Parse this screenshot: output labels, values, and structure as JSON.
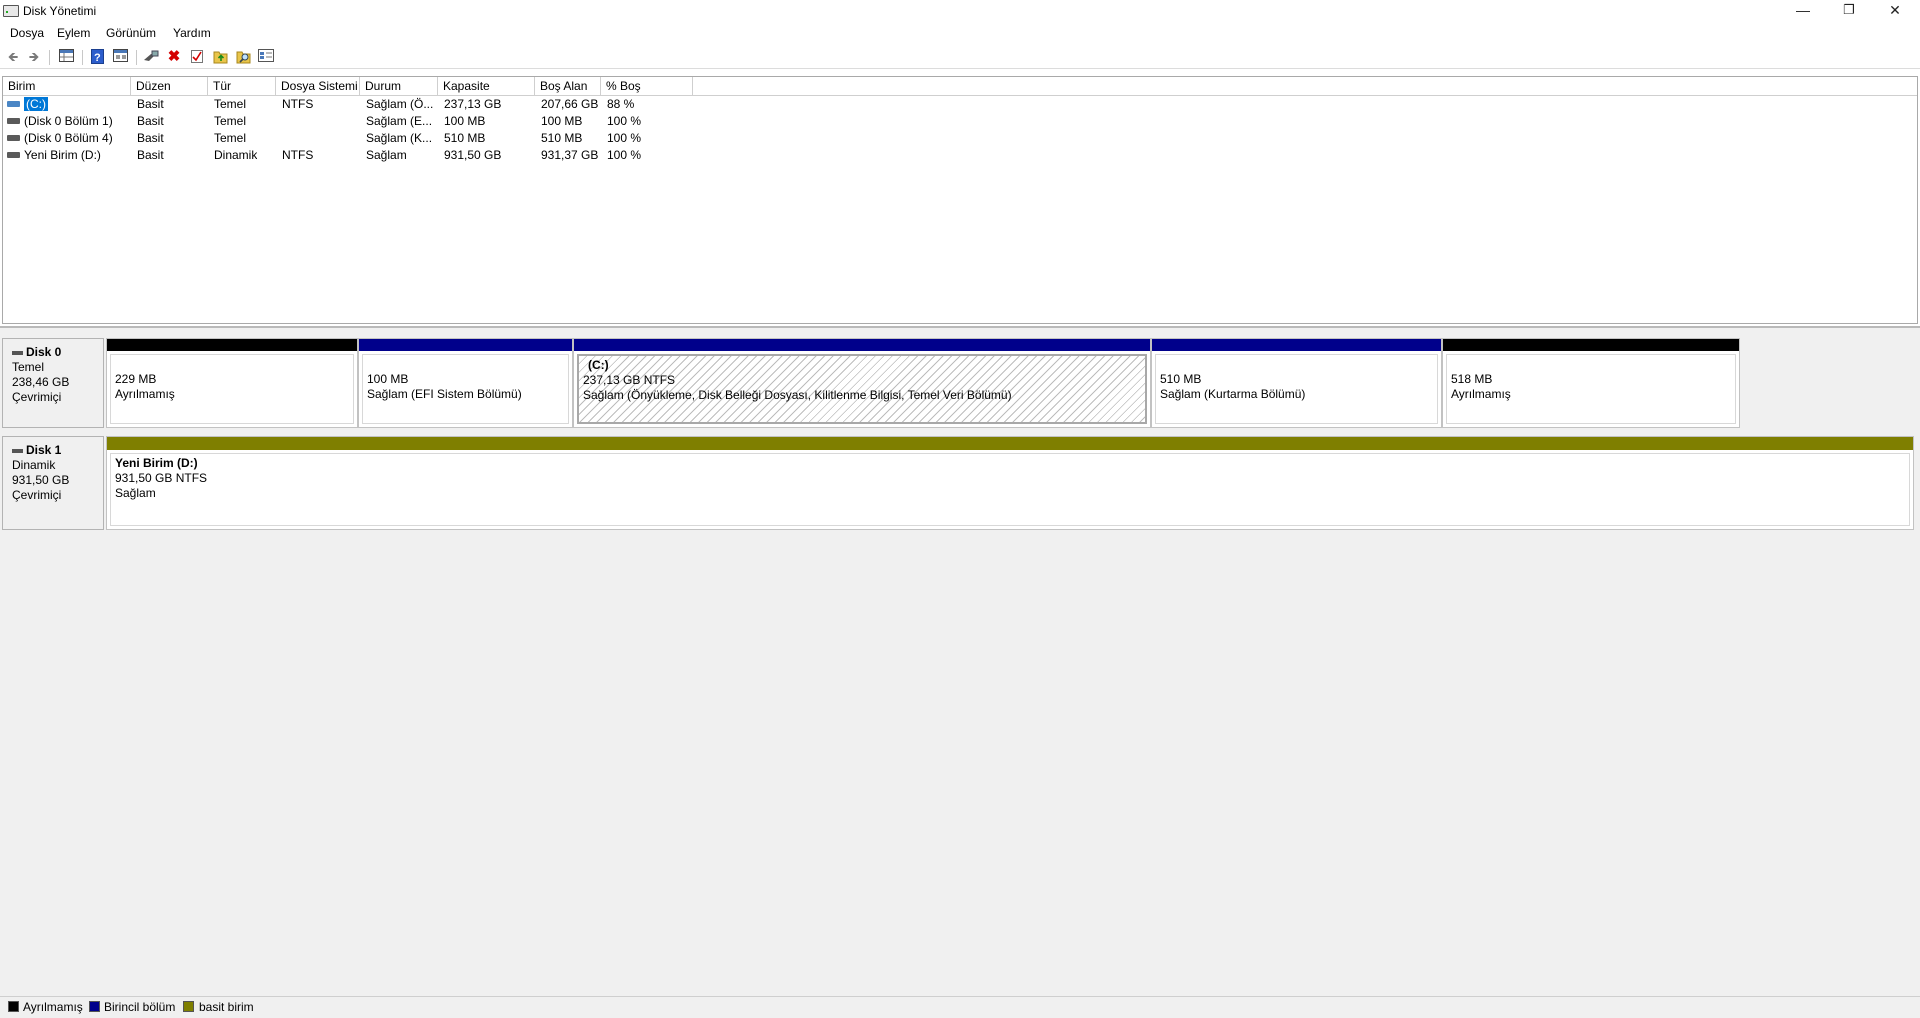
{
  "window": {
    "title": "Disk Yönetimi"
  },
  "menu": [
    "Dosya",
    "Eylem",
    "Görünüm",
    "Yardım"
  ],
  "window_controls": {
    "minimize": "—",
    "restore": "❐",
    "close": "✕"
  },
  "toolbar": {
    "icons": [
      "back-icon",
      "forward-icon",
      "properties-grid-icon",
      "help-icon",
      "view-grid-icon",
      "connect-disk-icon",
      "delete-icon",
      "check-icon",
      "format-up-icon",
      "search-icon",
      "settings-panel-icon"
    ]
  },
  "volume_list": {
    "columns": [
      "Birim",
      "Düzen",
      "Tür",
      "Dosya Sistemi",
      "Durum",
      "Kapasite",
      "Boş Alan",
      "% Boş"
    ],
    "rows": [
      {
        "birim": "(C:)",
        "duzen": "Basit",
        "tur": "Temel",
        "fs": "NTFS",
        "durum": "Sağlam (Ö...",
        "kapasite": "237,13 GB",
        "bos": "207,66 GB",
        "yuzde": "88 %",
        "selected": true
      },
      {
        "birim": "(Disk 0 Bölüm 1)",
        "duzen": "Basit",
        "tur": "Temel",
        "fs": "",
        "durum": "Sağlam (E...",
        "kapasite": "100 MB",
        "bos": "100 MB",
        "yuzde": "100 %"
      },
      {
        "birim": "(Disk 0 Bölüm 4)",
        "duzen": "Basit",
        "tur": "Temel",
        "fs": "",
        "durum": "Sağlam (K...",
        "kapasite": "510 MB",
        "bos": "510 MB",
        "yuzde": "100 %"
      },
      {
        "birim": "Yeni Birim (D:)",
        "duzen": "Basit",
        "tur": "Dinamik",
        "fs": "NTFS",
        "durum": "Sağlam",
        "kapasite": "931,50 GB",
        "bos": "931,37 GB",
        "yuzde": "100 %"
      }
    ]
  },
  "disks": [
    {
      "name": "Disk 0",
      "type": "Temel",
      "size": "238,46 GB",
      "status": "Çevrimiçi",
      "partitions": [
        {
          "title": "",
          "line1": "229 MB",
          "line2": "Ayrılmamış",
          "bar_color": "#000000"
        },
        {
          "title": "",
          "line1": "100 MB",
          "line2": "Sağlam (EFI Sistem Bölümü)",
          "bar_color": "#00008b"
        },
        {
          "title": "(C:)",
          "line1": "237,13 GB NTFS",
          "line2": "Sağlam (Önyükleme, Disk Belleği Dosyası, Kilitlenme Bilgisi, Temel Veri Bölümü)",
          "bar_color": "#00008b"
        },
        {
          "title": "",
          "line1": "510 MB",
          "line2": "Sağlam (Kurtarma Bölümü)",
          "bar_color": "#00008b"
        },
        {
          "title": "",
          "line1": "518 MB",
          "line2": "Ayrılmamış",
          "bar_color": "#000000"
        }
      ]
    },
    {
      "name": "Disk 1",
      "type": "Dinamik",
      "size": "931,50 GB",
      "status": "Çevrimiçi",
      "partitions": [
        {
          "title": "Yeni Birim  (D:)",
          "line1": "931,50 GB NTFS",
          "line2": "Sağlam",
          "bar_color": "#7f7f00"
        }
      ]
    }
  ],
  "legend": [
    {
      "label": "Ayrılmamış",
      "color": "#000000"
    },
    {
      "label": "Birincil bölüm",
      "color": "#00008b"
    },
    {
      "label": "basit birim",
      "color": "#7f7f00"
    }
  ]
}
